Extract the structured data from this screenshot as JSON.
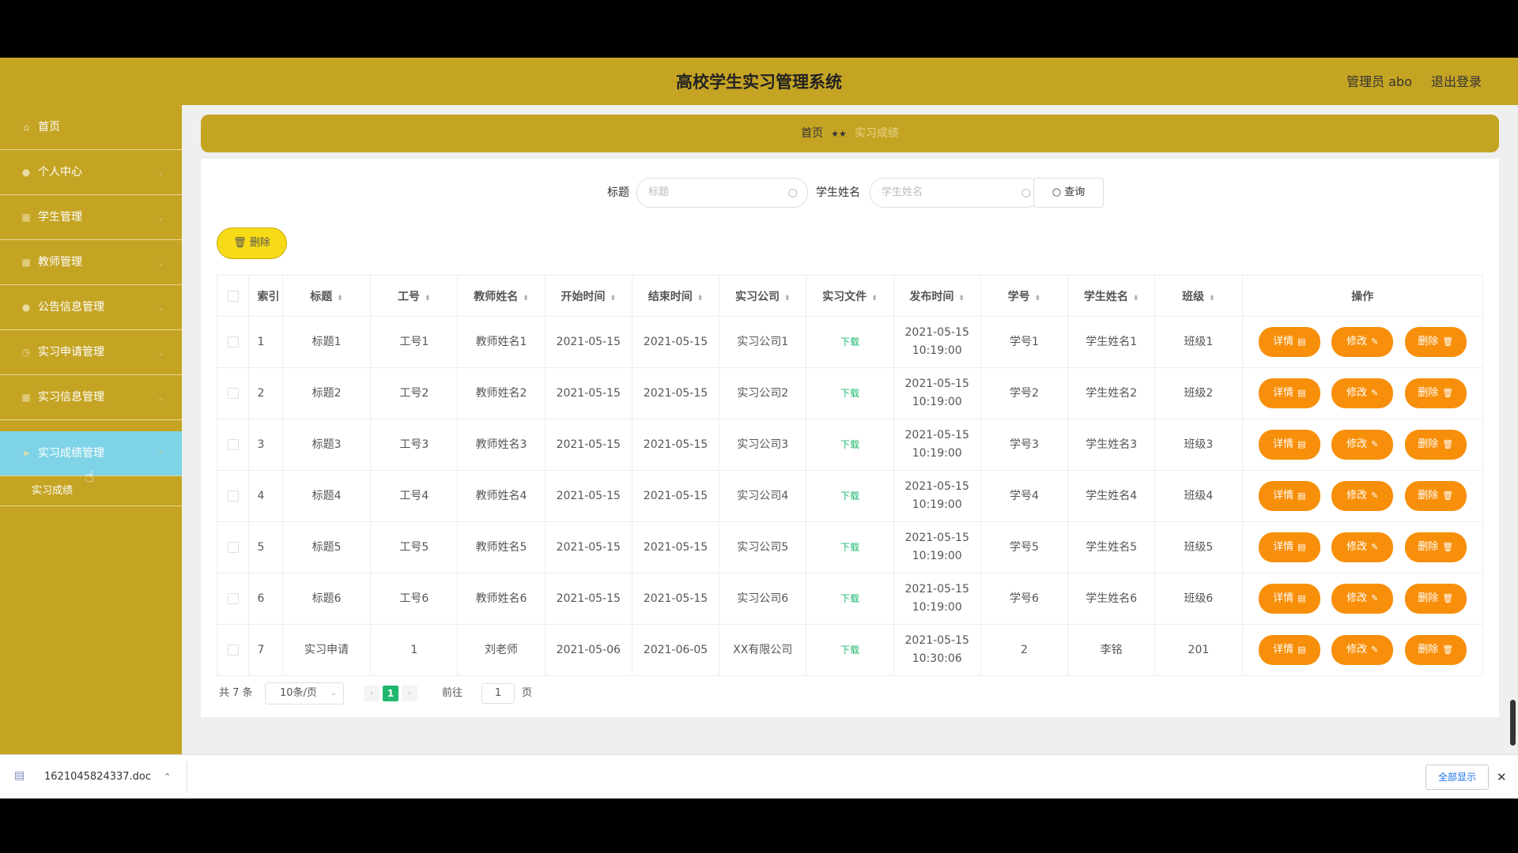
{
  "header": {
    "title": "高校学生实习管理系统",
    "admin": "管理员 abo",
    "logout": "退出登录"
  },
  "sidebar": {
    "items": [
      {
        "label": "首页",
        "icon": "home-icon"
      },
      {
        "label": "个人中心",
        "icon": "user-icon"
      },
      {
        "label": "学生管理",
        "icon": "grid-icon"
      },
      {
        "label": "教师管理",
        "icon": "grid-icon"
      },
      {
        "label": "公告信息管理",
        "icon": "user-icon"
      },
      {
        "label": "实习申请管理",
        "icon": "clock-icon"
      },
      {
        "label": "实习信息管理",
        "icon": "grid-icon"
      },
      {
        "label": "实习成绩管理",
        "icon": "send-icon"
      }
    ],
    "sub_item": "实习成绩"
  },
  "breadcrumb": {
    "home": "首页",
    "separator": "★★",
    "current": "实习成绩"
  },
  "search": {
    "title_label": "标题",
    "title_placeholder": "标题",
    "name_label": "学生姓名",
    "name_placeholder": "学生姓名",
    "query_button": "查询"
  },
  "toolbar": {
    "delete_label": "删除"
  },
  "table": {
    "headers": [
      "索引",
      "标题",
      "工号",
      "教师姓名",
      "开始时间",
      "结束时间",
      "实习公司",
      "实习文件",
      "发布时间",
      "学号",
      "学生姓名",
      "班级",
      "操作"
    ],
    "rows": [
      {
        "index": "1",
        "title": "标题1",
        "job_no": "工号1",
        "teacher": "教师姓名1",
        "start": "2021-05-15",
        "end": "2021-05-15",
        "company": "实习公司1",
        "file": "下载",
        "pub_date": "2021-05-15",
        "pub_time": "10:19:00",
        "student_no": "学号1",
        "student": "学生姓名1",
        "class": "班级1"
      },
      {
        "index": "2",
        "title": "标题2",
        "job_no": "工号2",
        "teacher": "教师姓名2",
        "start": "2021-05-15",
        "end": "2021-05-15",
        "company": "实习公司2",
        "file": "下载",
        "pub_date": "2021-05-15",
        "pub_time": "10:19:00",
        "student_no": "学号2",
        "student": "学生姓名2",
        "class": "班级2"
      },
      {
        "index": "3",
        "title": "标题3",
        "job_no": "工号3",
        "teacher": "教师姓名3",
        "start": "2021-05-15",
        "end": "2021-05-15",
        "company": "实习公司3",
        "file": "下载",
        "pub_date": "2021-05-15",
        "pub_time": "10:19:00",
        "student_no": "学号3",
        "student": "学生姓名3",
        "class": "班级3"
      },
      {
        "index": "4",
        "title": "标题4",
        "job_no": "工号4",
        "teacher": "教师姓名4",
        "start": "2021-05-15",
        "end": "2021-05-15",
        "company": "实习公司4",
        "file": "下载",
        "pub_date": "2021-05-15",
        "pub_time": "10:19:00",
        "student_no": "学号4",
        "student": "学生姓名4",
        "class": "班级4"
      },
      {
        "index": "5",
        "title": "标题5",
        "job_no": "工号5",
        "teacher": "教师姓名5",
        "start": "2021-05-15",
        "end": "2021-05-15",
        "company": "实习公司5",
        "file": "下载",
        "pub_date": "2021-05-15",
        "pub_time": "10:19:00",
        "student_no": "学号5",
        "student": "学生姓名5",
        "class": "班级5"
      },
      {
        "index": "6",
        "title": "标题6",
        "job_no": "工号6",
        "teacher": "教师姓名6",
        "start": "2021-05-15",
        "end": "2021-05-15",
        "company": "实习公司6",
        "file": "下载",
        "pub_date": "2021-05-15",
        "pub_time": "10:19:00",
        "student_no": "学号6",
        "student": "学生姓名6",
        "class": "班级6"
      },
      {
        "index": "7",
        "title": "实习申请",
        "job_no": "1",
        "teacher": "刘老师",
        "start": "2021-05-06",
        "end": "2021-06-05",
        "company": "XX有限公司",
        "file": "下载",
        "pub_date": "2021-05-15",
        "pub_time": "10:30:06",
        "student_no": "2",
        "student": "李铭",
        "class": "201"
      }
    ],
    "actions": {
      "detail": "详情",
      "edit": "修改",
      "delete": "删除"
    }
  },
  "pagination": {
    "total": "共 7 条",
    "page_size": "10条/页",
    "current_page": "1",
    "goto_label": "前往",
    "goto_value": "1",
    "page_unit": "页"
  },
  "download_bar": {
    "file_name": "1621045824337.doc",
    "show_all": "全部显示"
  },
  "colors": {
    "header_bg": "#c5a424",
    "active_menu": "#7fd3e6",
    "action_button": "#f88f0a",
    "delete_button": "#f7da16",
    "link_green": "#1fb86e"
  }
}
